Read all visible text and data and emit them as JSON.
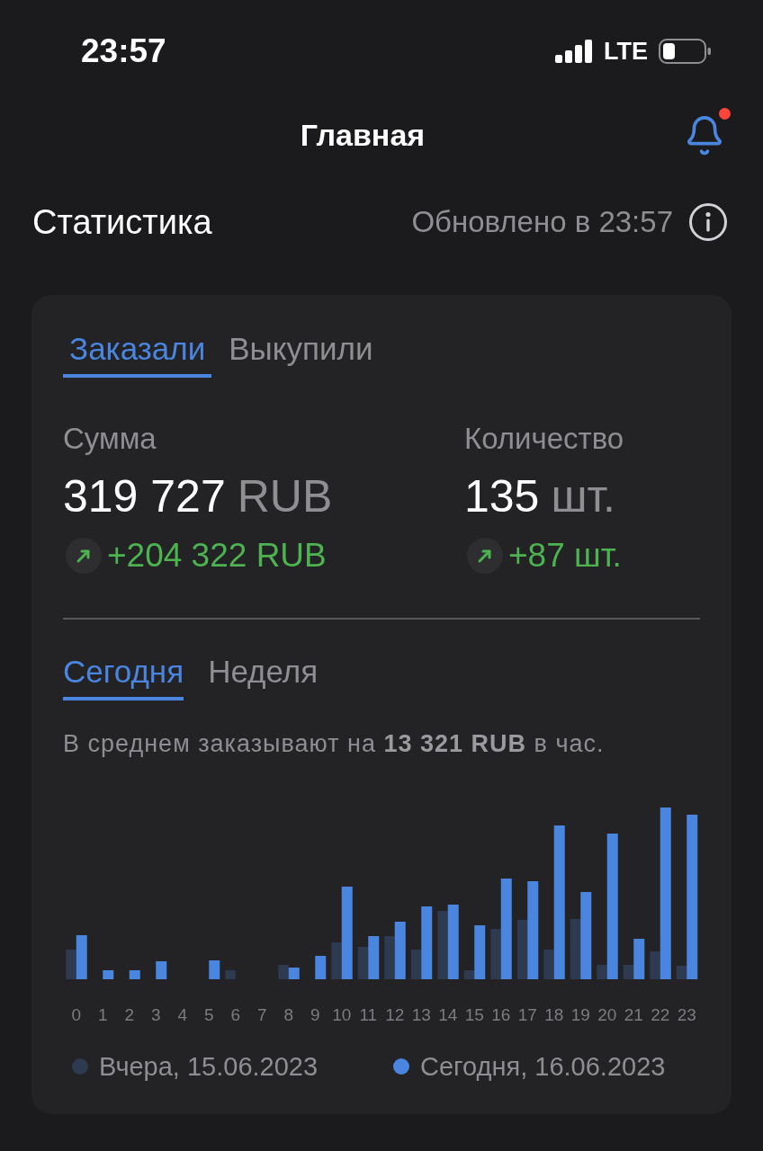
{
  "status_bar": {
    "time": "23:57",
    "network": "LTE"
  },
  "header": {
    "title": "Главная",
    "has_unread": true
  },
  "statistics": {
    "title": "Статистика",
    "updated": "Обновлено в 23:57"
  },
  "card": {
    "tabs": [
      {
        "label": "Заказали",
        "selected": true
      },
      {
        "label": "Выкупили",
        "selected": false
      }
    ],
    "metrics": [
      {
        "label": "Сумма",
        "value": "319 727",
        "unit": "RUB",
        "change": "+204 322 RUB",
        "rising": true
      },
      {
        "label": "Количество",
        "value": "135",
        "unit": "шт.",
        "change": "+87 шт.",
        "rising": true
      }
    ],
    "period_tabs": [
      {
        "label": "Сегодня",
        "selected": true
      },
      {
        "label": "Неделя",
        "selected": false
      }
    ],
    "summary": "В среднем заказывают на **13 321 RUB** в час.",
    "hourly_chart": {
      "x_labels": [
        "0",
        "1",
        "2",
        "3",
        "4",
        "5",
        "6",
        "7",
        "8",
        "9",
        "10",
        "11",
        "12",
        "13",
        "14",
        "15",
        "16",
        "17",
        "18",
        "19",
        "20",
        "21",
        "22",
        "23"
      ],
      "legend": [
        {
          "label": "Вчера, 15.06.2023",
          "color": "#2e3a50"
        },
        {
          "label": "Сегодня, 16.06.2023",
          "color": "#4a86e0"
        }
      ]
    }
  }
}
